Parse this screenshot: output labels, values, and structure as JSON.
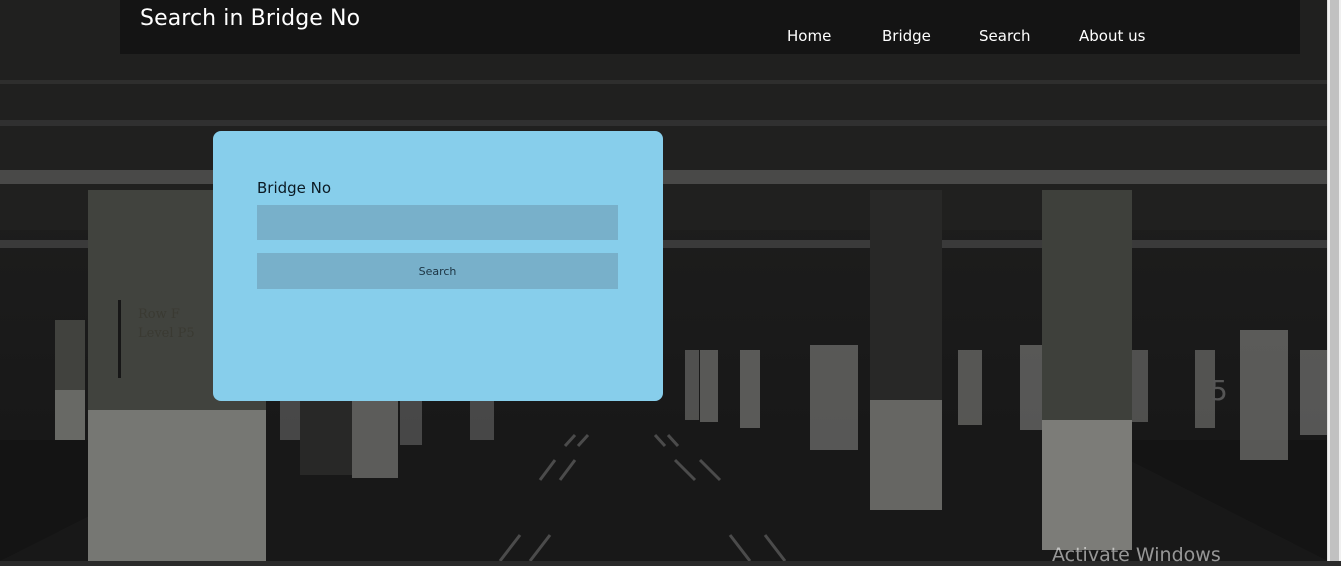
{
  "header": {
    "title": "Search in Bridge No",
    "nav": [
      {
        "label": "Home"
      },
      {
        "label": "Bridge"
      },
      {
        "label": "Search"
      },
      {
        "label": "About us"
      }
    ]
  },
  "form": {
    "field_label": "Bridge No",
    "input_value": "",
    "button_label": "Search"
  },
  "background": {
    "sign_line1": "Row F",
    "sign_line2": "Level P5",
    "pillar_mark": "5"
  },
  "os_watermark": "Activate Windows",
  "colors": {
    "card": "#87ceeb",
    "input": "#78b0ca",
    "header_text": "#ffffff"
  }
}
